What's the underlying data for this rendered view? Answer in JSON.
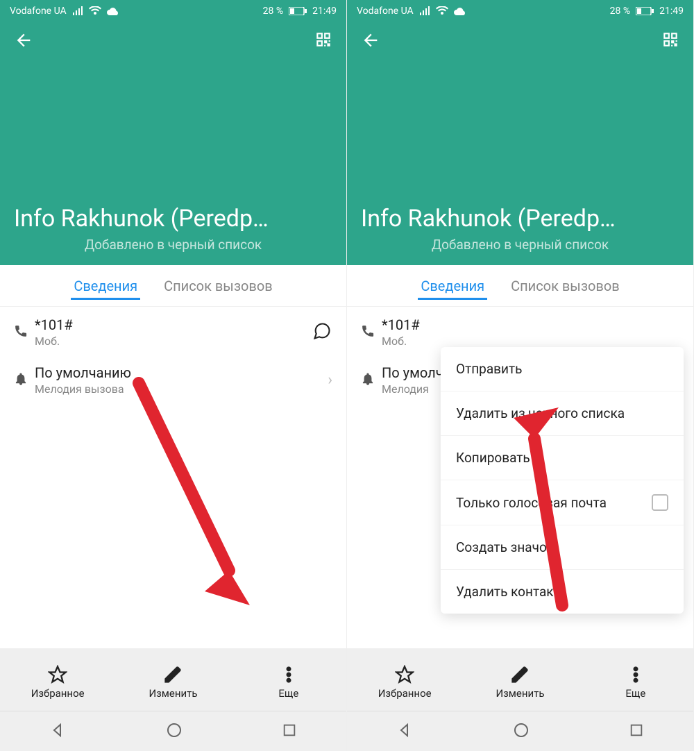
{
  "status": {
    "carrier": "Vodafone UA",
    "battery_pct": "28 %",
    "time": "21:49"
  },
  "header": {
    "name": "Info Rakhunok (Peredp…",
    "subtitle": "Добавлено в черный список"
  },
  "tabs": {
    "details": "Сведения",
    "calls": "Список вызовов"
  },
  "phone_row": {
    "number": "*101#",
    "type": "Моб."
  },
  "ringtone_row": {
    "title": "По умолчанию",
    "sub": "Мелодия вызова",
    "title_trunc": "По умолч",
    "sub_trunc": "Мелодия"
  },
  "bottom": {
    "fav": "Избранное",
    "edit": "Изменить",
    "more": "Еще"
  },
  "popup": {
    "send": "Отправить",
    "unblock": "Удалить из черного списка",
    "copy": "Копировать",
    "voicemail": "Только голосовая почта",
    "shortcut": "Создать значок",
    "delete": "Удалить контакт"
  }
}
